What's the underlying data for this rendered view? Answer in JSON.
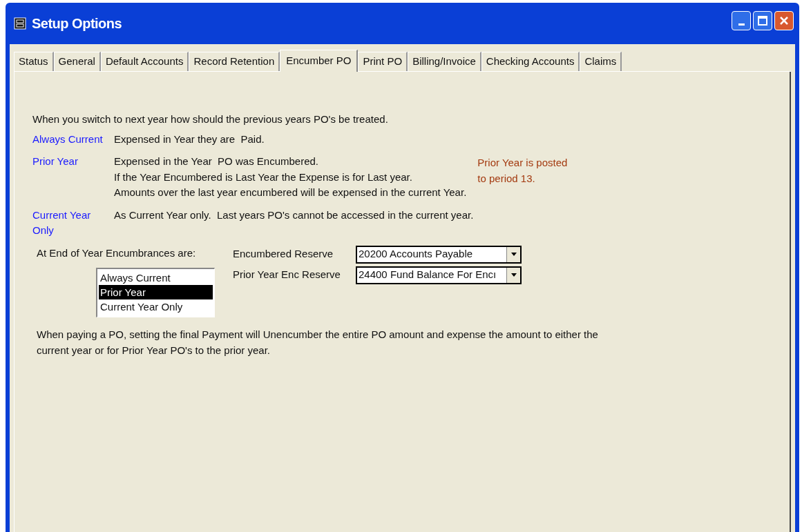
{
  "window": {
    "title": "Setup Options"
  },
  "tabs": [
    {
      "label": "Status",
      "selected": false
    },
    {
      "label": "General",
      "selected": false
    },
    {
      "label": "Default Accounts",
      "selected": false
    },
    {
      "label": "Record Retention",
      "selected": false
    },
    {
      "label": "Encumber PO",
      "selected": true
    },
    {
      "label": "Print PO",
      "selected": false
    },
    {
      "label": "Billing/Invoice",
      "selected": false
    },
    {
      "label": "Checking Accounts",
      "selected": false
    },
    {
      "label": "Claims",
      "selected": false
    }
  ],
  "intro": "When you switch to next year how should the previous years PO's be treated.",
  "options": [
    {
      "label": "Always Current",
      "lines": [
        "Expensed in Year they are  Paid."
      ]
    },
    {
      "label": "Prior Year",
      "lines": [
        "Expensed in the Year  PO was Encumbered.",
        "If the Year Encumbered is Last Year the Expense is for Last year.",
        "Amounts over the last year encumbered will be expensed in the current Year."
      ],
      "note": [
        "Prior Year is posted",
        "to period 13."
      ]
    },
    {
      "label": "Current Year\n Only",
      "lines": [
        "As Current Year only.  Last years PO's cannot be accessed in the current year."
      ]
    }
  ],
  "end_of_year_label": "At End of Year Encumbrances are:",
  "listbox": [
    {
      "label": "Always Current",
      "selected": false
    },
    {
      "label": "Prior Year",
      "selected": true
    },
    {
      "label": "Current Year Only",
      "selected": false
    }
  ],
  "fields": [
    {
      "label": "Encumbered Reserve",
      "value": "20200 Accounts Payable"
    },
    {
      "label": "Prior Year Enc Reserve",
      "value": "24400 Fund Balance For Encı"
    }
  ],
  "footer": "When paying a PO, setting the final Payment will Unencumber the entire PO amount and expense the amount to either the current year or for Prior Year PO's to the prior year."
}
